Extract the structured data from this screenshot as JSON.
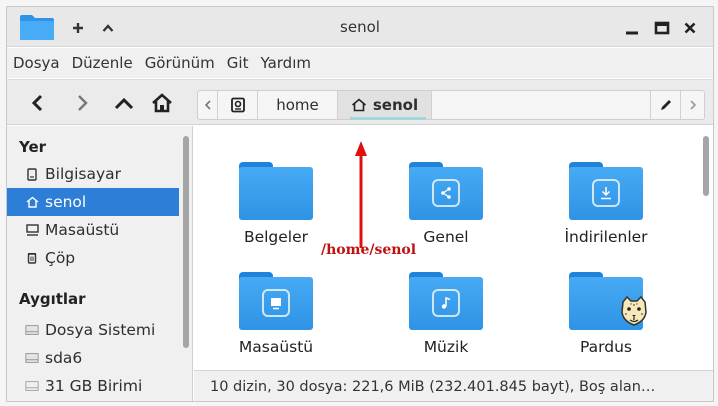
{
  "window": {
    "title": "senol"
  },
  "menubar": {
    "items": [
      "Dosya",
      "Düzenle",
      "Görünüm",
      "Git",
      "Yardım"
    ]
  },
  "pathbar": {
    "segments": [
      "home",
      "senol"
    ],
    "active": "senol"
  },
  "sidebar": {
    "places_header": "Yer",
    "places": [
      {
        "label": "Bilgisayar",
        "icon": "computer-icon"
      },
      {
        "label": "senol",
        "icon": "home-icon",
        "selected": true
      },
      {
        "label": "Masaüstü",
        "icon": "desktop-icon"
      },
      {
        "label": "Çöp",
        "icon": "trash-icon"
      }
    ],
    "devices_header": "Aygıtlar",
    "devices": [
      {
        "label": "Dosya Sistemi",
        "icon": "drive-icon"
      },
      {
        "label": "sda6",
        "icon": "drive-icon"
      },
      {
        "label": "31 GB Birimi",
        "icon": "drive-icon"
      }
    ]
  },
  "folders": [
    {
      "label": "Belgeler",
      "icon": "folder-icon"
    },
    {
      "label": "Genel",
      "icon": "folder-share-icon"
    },
    {
      "label": "İndirilenler",
      "icon": "folder-download-icon"
    },
    {
      "label": "Masaüstü",
      "icon": "folder-desktop-icon"
    },
    {
      "label": "Müzik",
      "icon": "folder-music-icon"
    },
    {
      "label": "Pardus",
      "icon": "folder-pardus-icon"
    }
  ],
  "annotation": {
    "text": "/home/senol",
    "color": "#c01010"
  },
  "status": {
    "text": "10 dizin, 30 dosya: 221,6 MiB (232.401.845 bayt), Boş alan…"
  },
  "colors": {
    "accent": "#2d7ed6",
    "folder": "#3a9bec"
  }
}
